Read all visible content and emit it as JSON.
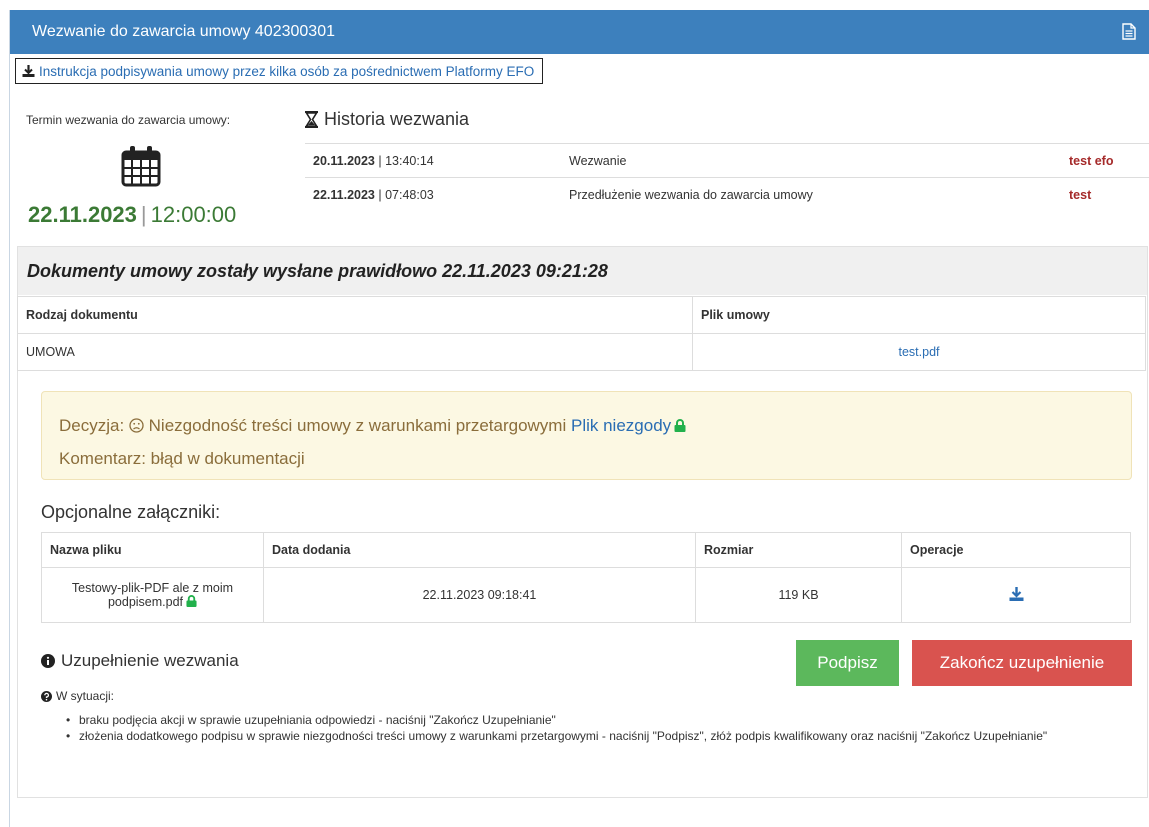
{
  "header": {
    "title": "Wezwanie do zawarcia umowy 402300301",
    "icon": "document-icon"
  },
  "instruction_link": "Instrukcja podpisywania umowy przez kilka osób za pośrednictwem Platformy EFO",
  "deadline": {
    "label": "Termin wezwania do zawarcia umowy:",
    "date": "22.11.2023",
    "separator": "|",
    "time": "12:00:00"
  },
  "history": {
    "title": "Historia wezwania",
    "rows": [
      {
        "date": "20.11.2023",
        "time": "13:40:14",
        "name": "Wezwanie",
        "user": "test efo"
      },
      {
        "date": "22.11.2023",
        "time": "07:48:03",
        "name": "Przedłużenie wezwania do zawarcia umowy",
        "user": "test"
      }
    ]
  },
  "sent_banner": "Dokumenty umowy zostały wysłane prawidłowo 22.11.2023 09:21:28",
  "documents": {
    "headers": [
      "Rodzaj dokumentu",
      "Plik umowy"
    ],
    "rows": [
      {
        "type": "UMOWA",
        "file": "test.pdf"
      }
    ]
  },
  "decision": {
    "prefix": "Decyzja:",
    "text": "Niezgodność treści umowy z warunkami przetargowymi",
    "file_link": "Plik niezgody",
    "comment": "Komentarz: błąd w dokumentacji"
  },
  "attachments": {
    "title": "Opcjonalne załączniki:",
    "headers": [
      "Nazwa pliku",
      "Data dodania",
      "Rozmiar",
      "Operacje"
    ],
    "rows": [
      {
        "name": "Testowy-plik-PDF ale z moim podpisem.pdf",
        "date": "22.11.2023 09:18:41",
        "size": "119 KB"
      }
    ]
  },
  "completion": {
    "title": "Uzupełnienie wezwania",
    "sign_button": "Podpisz",
    "end_button": "Zakończ uzupełnienie",
    "situation_label": "W sytuacji:",
    "items": [
      "braku podjęcia akcji w sprawie uzupełniania odpowiedzi - naciśnij \"Zakończ Uzupełnianie\"",
      "złożenia dodatkowego podpisu w sprawie niezgodności treści umowy z warunkami przetargowymi - naciśnij \"Podpisz\", złóż podpis kwalifikowany oraz naciśnij \"Zakończ Uzupełnianie\""
    ]
  },
  "colors": {
    "header_bg": "#3d80bd",
    "link": "#2a6db3",
    "date_green": "#3b7a35",
    "user_red": "#a52a2a",
    "alert_bg": "#fcf8e3",
    "alert_text": "#8a6d3b",
    "sign_green": "#5cb85c",
    "end_red": "#d9534f",
    "lock_green": "#22b14c"
  }
}
